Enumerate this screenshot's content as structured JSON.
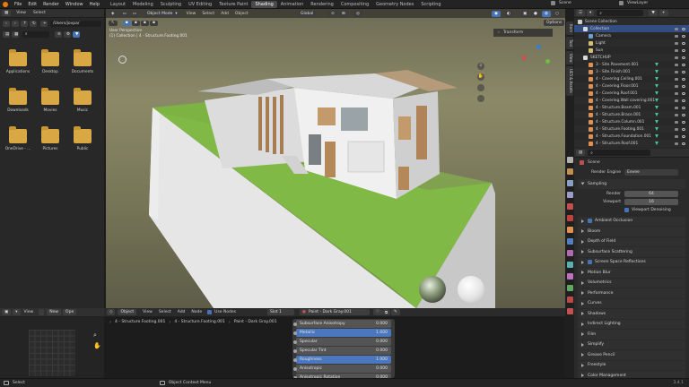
{
  "topbar": {
    "menus": [
      "File",
      "Edit",
      "Render",
      "Window",
      "Help"
    ],
    "workspaces": [
      "Layout",
      "Modeling",
      "Sculpting",
      "UV Editing",
      "Texture Paint",
      "Shading",
      "Animation",
      "Rendering",
      "Compositing",
      "Geometry Nodes",
      "Scripting"
    ],
    "active_workspace": "Shading",
    "scene_label": "Scene",
    "viewlayer_label": "ViewLayer"
  },
  "filebrowser": {
    "menu_view": "View",
    "menu_select": "Select",
    "path": "/Users/jovpa/",
    "items": [
      "Applications",
      "Desktop",
      "Documents",
      "Downloads",
      "Movies",
      "Music",
      "OneDrive - ...",
      "Pictures",
      "Public"
    ]
  },
  "viewport": {
    "mode": "Object Mode",
    "menus": [
      "View",
      "Select",
      "Add",
      "Object"
    ],
    "transform_orientation": "Global",
    "perspective_line": "User Perspective",
    "collection_line": "(1) Collection | 4 - Structure.Footing.001",
    "options_label": "Options",
    "transform_panel": "Transform"
  },
  "sidebar_tabs": [
    "Item",
    "Tool",
    "View",
    "UE5 & Assets"
  ],
  "outliner": {
    "title": "Scene Collection",
    "rows": [
      {
        "label": "Collection",
        "indent": 1,
        "color": "#d8d8d8",
        "sel": true
      },
      {
        "label": "Camera",
        "indent": 2,
        "color": "#6aa0d0",
        "sel": false
      },
      {
        "label": "Light",
        "indent": 2,
        "color": "#d0c070",
        "sel": false
      },
      {
        "label": "Sun",
        "indent": 2,
        "color": "#d0c070",
        "sel": false
      },
      {
        "label": "SKETCHUP",
        "indent": 1,
        "color": "#d8d8d8",
        "sel": false
      },
      {
        "label": "3 - Site.Pavement.001",
        "indent": 2,
        "color": "#e09050",
        "sel": false
      },
      {
        "label": "3 - Site.Finish.001",
        "indent": 2,
        "color": "#e09050",
        "sel": false
      },
      {
        "label": "4 - Covering.Ceiling.001",
        "indent": 2,
        "color": "#e09050",
        "sel": false
      },
      {
        "label": "4 - Covering.Floor.001",
        "indent": 2,
        "color": "#e09050",
        "sel": false
      },
      {
        "label": "4 - Covering.Roof.001",
        "indent": 2,
        "color": "#e09050",
        "sel": false
      },
      {
        "label": "4 - Covering.Wall covering.001",
        "indent": 2,
        "color": "#e09050",
        "sel": false
      },
      {
        "label": "4 - Structure.Beam.001",
        "indent": 2,
        "color": "#e09050",
        "sel": false
      },
      {
        "label": "4 - Structure.Brace.001",
        "indent": 2,
        "color": "#e09050",
        "sel": false
      },
      {
        "label": "4 - Structure.Column.001",
        "indent": 2,
        "color": "#e09050",
        "sel": false
      },
      {
        "label": "4 - Structure.Footing.001",
        "indent": 2,
        "color": "#e09050",
        "sel": false
      },
      {
        "label": "4 - Structure.Foundation.001",
        "indent": 2,
        "color": "#e09050",
        "sel": false
      },
      {
        "label": "4 - Structure.Roof.001",
        "indent": 2,
        "color": "#e09050",
        "sel": false
      }
    ]
  },
  "properties": {
    "scene_label": "Scene",
    "render_engine_label": "Render Engine",
    "render_engine_value": "Eevee",
    "sampling_label": "Sampling",
    "render_label": "Render",
    "render_value": "64",
    "viewport_label": "Viewport",
    "viewport_value": "16",
    "denoise_label": "Viewport Denoising",
    "sections": [
      "Ambient Occlusion",
      "Bloom",
      "Depth of Field",
      "Subsurface Scattering",
      "Screen Space Reflections",
      "Motion Blur",
      "Volumetrics",
      "Performance",
      "Curves",
      "Shadows",
      "Indirect Lighting",
      "Film",
      "Simplify",
      "Grease Pencil",
      "Freestyle",
      "Color Management"
    ],
    "checked_sections": [
      "Ambient Occlusion",
      "Screen Space Reflections"
    ]
  },
  "image_editor": {
    "menu_view": "View",
    "new_label": "New",
    "open_label": "Ope"
  },
  "node_editor": {
    "type_label": "Object",
    "menus": [
      "View",
      "Select",
      "Add",
      "Node"
    ],
    "use_nodes_label": "Use Nodes",
    "slot_label": "Slot 1",
    "material_label": "Paint - Dark Gray.001",
    "breadcrumb": [
      "4 - Structure.Footing.001",
      "4 - Structure.Footing.001",
      "Paint - Dark Gray.001"
    ],
    "rows": [
      {
        "label": "Subsurface Anisotropy",
        "value": "0.000",
        "blue": false
      },
      {
        "label": "Metallic",
        "value": "1.000",
        "blue": true
      },
      {
        "label": "Specular",
        "value": "0.000",
        "blue": false
      },
      {
        "label": "Specular Tint",
        "value": "0.000",
        "blue": false
      },
      {
        "label": "Roughness",
        "value": "1.000",
        "blue": true
      },
      {
        "label": "Anisotropic",
        "value": "0.000",
        "blue": false
      },
      {
        "label": "Anisotropic Rotation",
        "value": "0.000",
        "blue": false
      }
    ]
  },
  "statusbar": {
    "left": "Select",
    "middle": "Object Context Menu",
    "version": "3.4.1"
  },
  "colors": {
    "accent_blue": "#4772b3",
    "selection_blue": "#334d80",
    "blender_orange": "#e87d0d",
    "grass_green": "#7cb342"
  }
}
